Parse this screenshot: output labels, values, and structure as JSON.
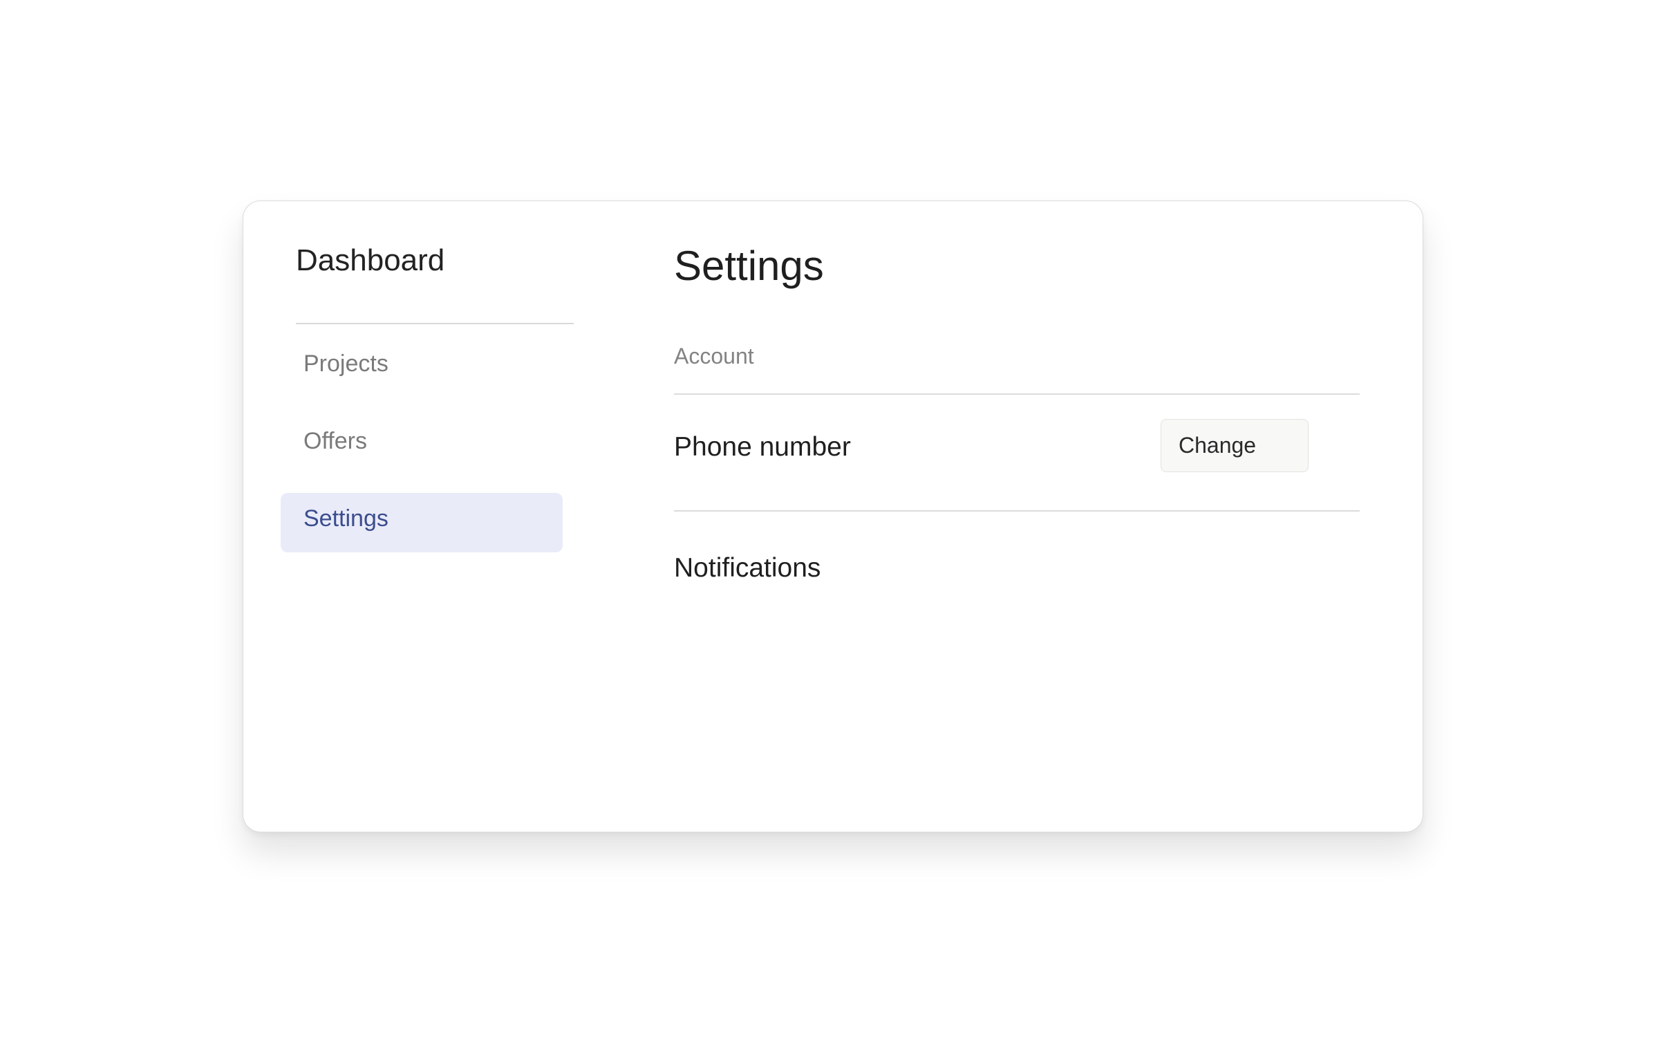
{
  "sidebar": {
    "brand": "Dashboard",
    "items": [
      {
        "label": "Projects",
        "active": false
      },
      {
        "label": "Offers",
        "active": false
      },
      {
        "label": "Settings",
        "active": true
      }
    ]
  },
  "main": {
    "title": "Settings",
    "section_label": "Account",
    "rows": [
      {
        "label": "Phone number",
        "action": "Change"
      },
      {
        "label": "Notifications"
      }
    ]
  },
  "colors": {
    "active_nav_background": "#e9ebf8",
    "active_nav_text": "#3b4d8d",
    "button_background": "#f8f8f6"
  }
}
